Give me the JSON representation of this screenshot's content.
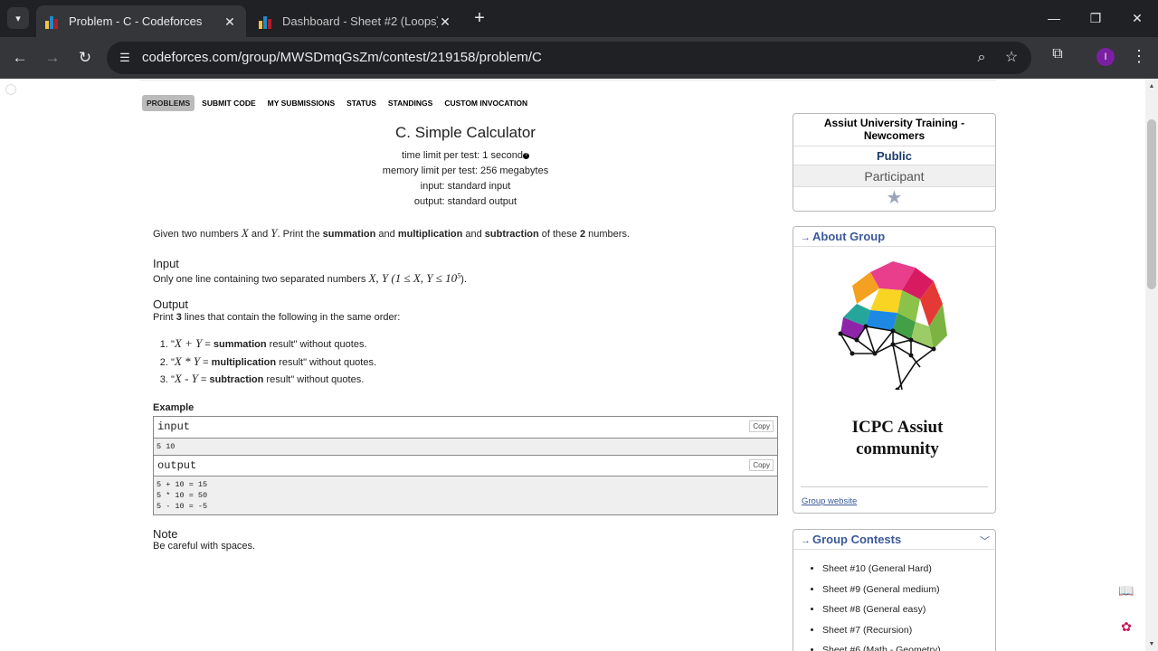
{
  "browser": {
    "tabs": [
      {
        "title": "Problem - C - Codeforces",
        "active": true
      },
      {
        "title": "Dashboard - Sheet #2 (Loops)",
        "active": false
      }
    ],
    "url": "codeforces.com/group/MWSDmqGsZm/contest/219158/problem/C",
    "profile_initial": "I"
  },
  "subnav": {
    "items": [
      "PROBLEMS",
      "SUBMIT CODE",
      "MY SUBMISSIONS",
      "STATUS",
      "STANDINGS",
      "CUSTOM INVOCATION"
    ]
  },
  "problem": {
    "title": "C. Simple Calculator",
    "time_limit": "time limit per test: 1 second",
    "memory_limit": "memory limit per test: 256 megabytes",
    "input_spec": "input: standard input",
    "output_spec": "output: standard output",
    "statement_pre": "Given two numbers",
    "statement_x": "X",
    "statement_and": "and",
    "statement_y": "Y",
    "statement_mid": ". Print the",
    "statement_b1": "summation",
    "statement_and2": "and",
    "statement_b2": "multiplication",
    "statement_and3": "and",
    "statement_b3": "subtraction",
    "statement_of": "of these",
    "statement_num": "2",
    "statement_end": "numbers.",
    "input_title": "Input",
    "input_text": "Only one line containing two separated numbers",
    "input_math": "X, Y (1 ≤ X, Y ≤ 10",
    "input_sup": "5",
    "input_close": ").",
    "output_title": "Output",
    "output_pre": "Print",
    "output_num": "3",
    "output_post": "lines that contain the following in the same order:",
    "list": [
      {
        "q": "\"",
        "m": "X + Y",
        "eq": " = ",
        "b": "summation",
        "rest": " result\" without quotes."
      },
      {
        "q": "\"",
        "m": "X * Y",
        "eq": " = ",
        "b": "multiplication",
        "rest": " result\" without quotes."
      },
      {
        "q": "\"",
        "m": "X - Y",
        "eq": " = ",
        "b": "subtraction",
        "rest": " result\" without quotes."
      }
    ],
    "example_title": "Example",
    "input_label": "input",
    "input_value": "5 10",
    "output_label": "output",
    "output_value": "5 + 10 = 15\n5 * 10 = 50\n5 - 10 = -5",
    "copy_label": "Copy",
    "note_title": "Note",
    "note_text": "Be careful with spaces."
  },
  "sidebar": {
    "group_name": "Assiut University Training - Newcomers",
    "visibility": "Public",
    "role": "Participant",
    "about_title": "About Group",
    "logo_line1": "ICPC Assiut",
    "logo_line2": "community",
    "group_website": "Group website",
    "contests_title": "Group Contests",
    "contests": [
      "Sheet #10 (General Hard)",
      "Sheet #9 (General medium)",
      "Sheet #8 (General easy)",
      "Sheet #7 (Recursion)",
      "Sheet #6 (Math - Geometry)"
    ]
  },
  "icons": {
    "tab_search": "chevron-down-icon",
    "back": "arrow-left-icon",
    "forward": "arrow-right-icon",
    "reload": "reload-icon",
    "site_info": "tune-icon",
    "zoom": "magnifier-icon",
    "bookmark": "star-icon",
    "extensions": "puzzle-icon",
    "menu": "kebab-icon"
  },
  "colors": {
    "chrome_dark": "#202124",
    "chrome_toolbar": "#35363a",
    "link_blue": "#3b5998"
  }
}
